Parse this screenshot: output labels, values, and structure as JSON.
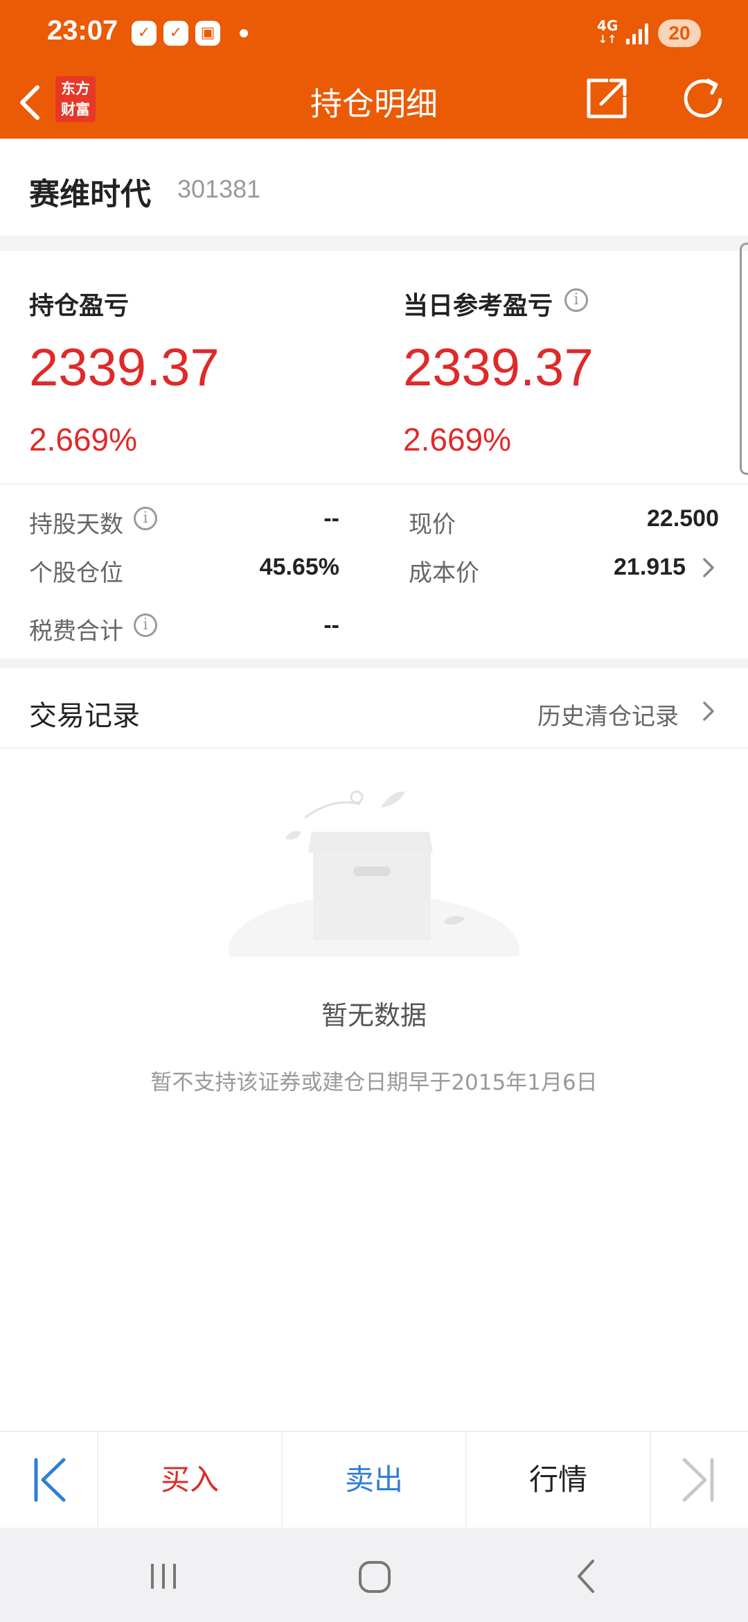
{
  "status_bar": {
    "time": "23:07",
    "network": "4G",
    "battery": "20"
  },
  "nav": {
    "title": "持仓明细",
    "logo_line1": "东方",
    "logo_line2": "财富"
  },
  "stock": {
    "name": "赛维时代",
    "code": "301381"
  },
  "pnl": {
    "position_label": "持仓盈亏",
    "position_value": "2339.37",
    "position_pct": "2.669%",
    "daily_label": "当日参考盈亏",
    "daily_value": "2339.37",
    "daily_pct": "2.669%"
  },
  "details": {
    "hold_days_label": "持股天数",
    "hold_days_value": "--",
    "position_ratio_label": "个股仓位",
    "position_ratio_value": "45.65%",
    "fees_label": "税费合计",
    "fees_value": "--",
    "price_label": "现价",
    "price_value": "22.500",
    "cost_label": "成本价",
    "cost_value": "21.915"
  },
  "trade": {
    "title": "交易记录",
    "history_link": "历史清仓记录",
    "empty_title": "暂无数据",
    "empty_note": "暂不支持该证券或建仓日期早于2015年1月6日"
  },
  "action_bar": {
    "buy": "买入",
    "sell": "卖出",
    "quote": "行情"
  },
  "colors": {
    "brand": "#eb5a05",
    "gain": "#de2a2a",
    "sell": "#2f7fd6"
  }
}
